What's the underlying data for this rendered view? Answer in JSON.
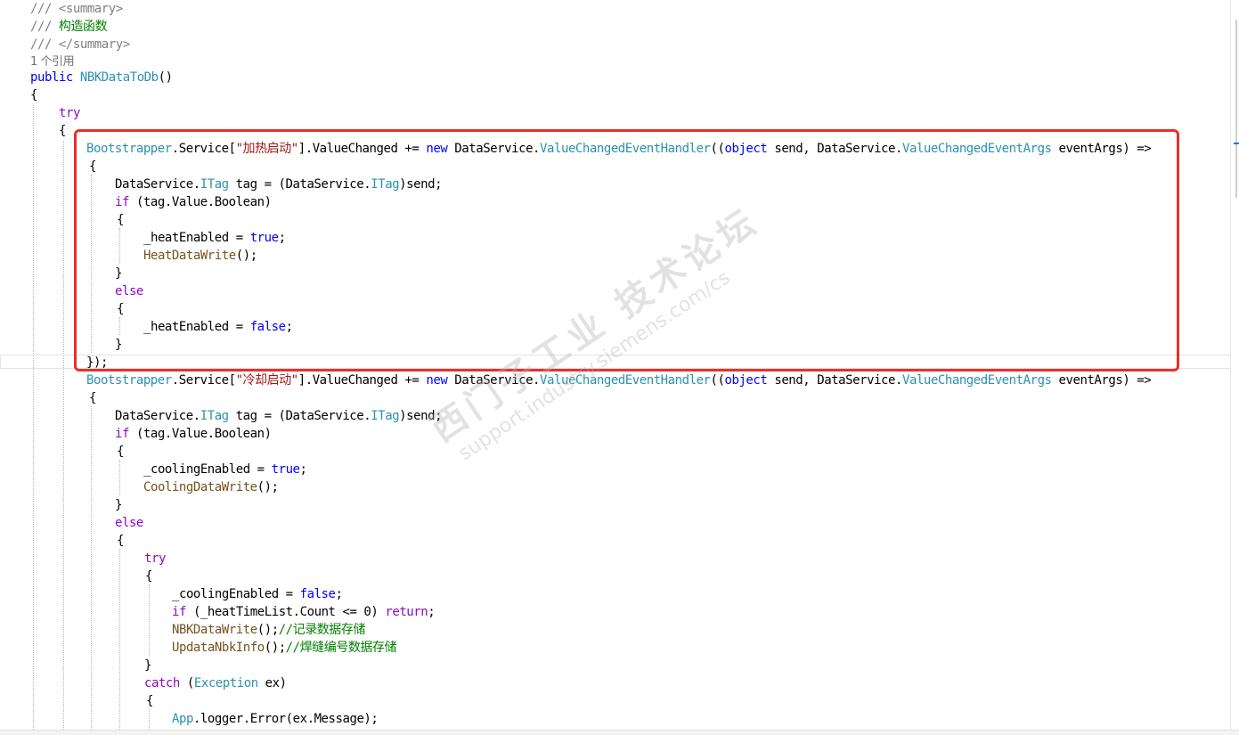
{
  "editor": {
    "doc_comment": {
      "open": "/// <summary>",
      "text_prefix": "/// ",
      "text": "构造函数",
      "close": "/// </summary>"
    },
    "reference_count": "1 个引用",
    "signature": {
      "modifier": "public",
      "name": "NBKDataToDb",
      "parens": "()"
    },
    "keywords": {
      "try": "try",
      "if": "if",
      "else": "else",
      "new": "new",
      "object": "object",
      "true": "true",
      "false": "false",
      "return": "return",
      "catch": "catch"
    },
    "types": {
      "bootstrapper": "Bootstrapper",
      "itag": "ITag",
      "handler": "ValueChangedEventHandler",
      "event_args": "ValueChangedEventArgs",
      "exception": "Exception",
      "app": "App"
    },
    "strings": {
      "heat": "\"加热启动\"",
      "cool": "\"冷却启动\""
    },
    "methods": {
      "heat_write": "HeatDataWrite",
      "cooling_write": "CoolingDataWrite",
      "nbk_write": "NBKDataWrite",
      "updata_info": "UpdataNbkInfo"
    },
    "comments": {
      "record": "//记录数据存储",
      "weld": "//焊缝编号数据存储"
    },
    "fragments": {
      "brace_open": "{",
      "brace_close": "}",
      "block_end": "});",
      "service_index_open": ".Service[",
      "value_changed": "].ValueChanged += ",
      "dataservice_dot": "DataService.",
      "handler_args_open": "((",
      "send_param": " send, ",
      "event_args_tail": " eventArgs) =>",
      "tag_decl_mid": " tag = (DataService.",
      "cast_send": ")send;",
      "if_cond": " (tag.Value.Boolean)",
      "heat_true": "_heatEnabled = ",
      "cool_true": "_coolingEnabled = ",
      "call_end": "();",
      "semi": ";",
      "heat_list_cond": " (_heatTimeList.Count <= 0) ",
      "catch_cond_open": " (",
      "catch_var": " ex)",
      "logger": ".logger.Error(ex.Message);"
    },
    "watermark": {
      "line1": "西门子工业 技术论坛",
      "line2": "support.industry.siemens.com/cs"
    }
  },
  "colors": {
    "keyword": "#0000ff",
    "control_keyword": "#8f08c4",
    "type": "#2b91af",
    "method": "#74531f",
    "string": "#a31515",
    "comment": "#008000",
    "doc_comment_tag": "#808080",
    "highlight_box": "#e8302b"
  }
}
